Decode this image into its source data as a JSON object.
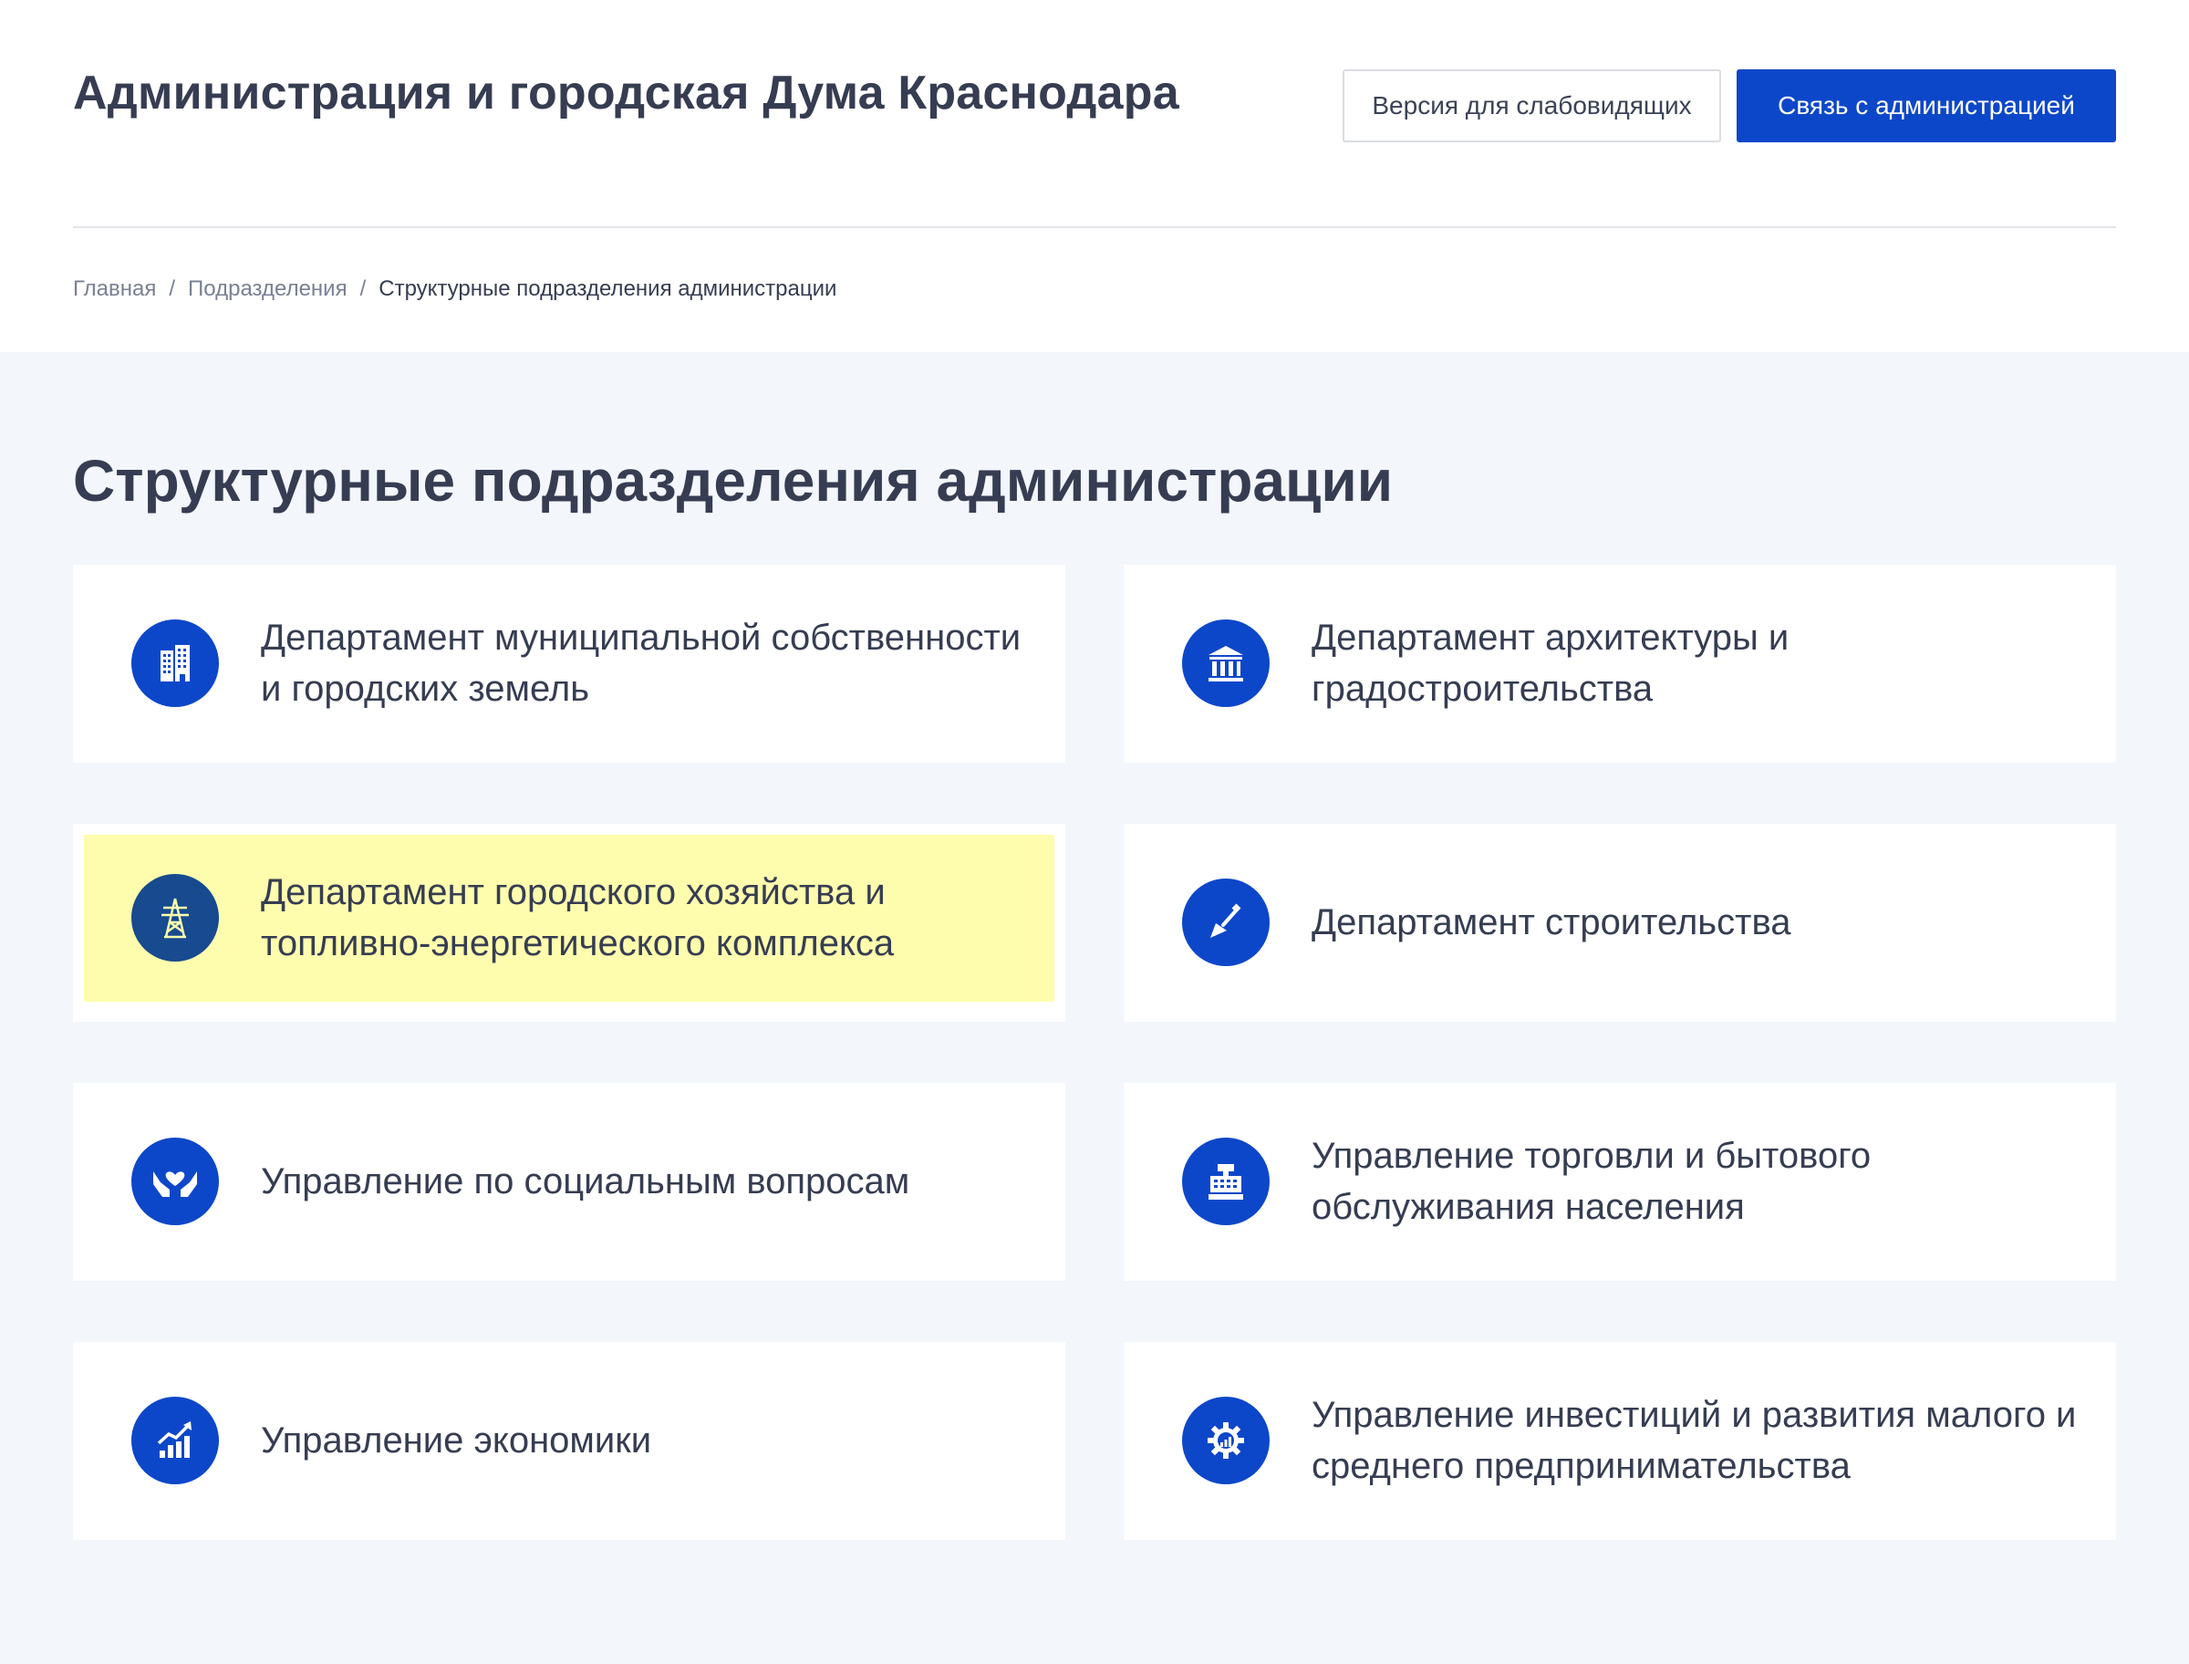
{
  "header": {
    "site_title": "Администрация и городская Дума Краснодара",
    "low_vision_label": "Версия для слабовидящих",
    "contact_label": "Связь с администрацией"
  },
  "breadcrumb": {
    "items": [
      "Главная",
      "Подразделения"
    ],
    "separator": "/",
    "current": "Структурные подразделения администрации"
  },
  "main": {
    "title": "Структурные подразделения администрации",
    "cards": [
      {
        "label": "Департамент муниципальной собственности и городских земель",
        "icon": "buildings-icon"
      },
      {
        "label": "Департамент архитектуры и градостроительства",
        "icon": "columns-building-icon"
      },
      {
        "label": "Департамент городского хозяйства и топливно-энергетического комплекса",
        "icon": "power-tower-icon"
      },
      {
        "label": "Департамент строительства",
        "icon": "trowel-icon"
      },
      {
        "label": "Управление по социальным вопросам",
        "icon": "caring-hands-icon"
      },
      {
        "label": "Управление торговли и бытового обслуживания населения",
        "icon": "cash-register-icon"
      },
      {
        "label": "Управление экономики",
        "icon": "growth-chart-icon"
      },
      {
        "label": "Управление инвестиций и развития малого и среднего предпринимательства",
        "icon": "gear-chart-icon"
      }
    ]
  },
  "colors": {
    "accent": "#0d47c9",
    "highlight": "#fefdae",
    "text": "#363d52",
    "page_bg": "#f3f6fb"
  }
}
